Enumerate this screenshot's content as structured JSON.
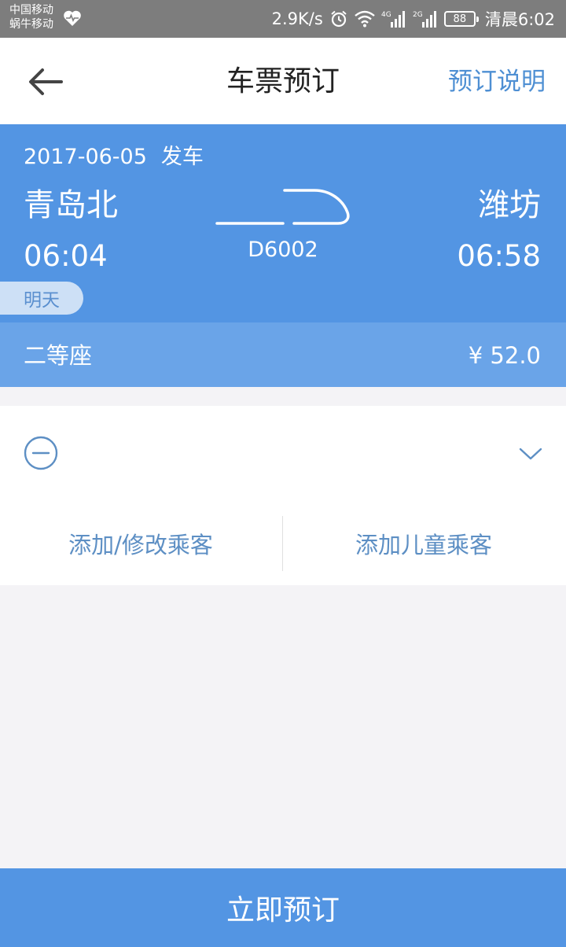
{
  "status_bar": {
    "carrier_1": "中国移动",
    "carrier_2": "蜗牛移动",
    "net_speed": "2.9K/s",
    "battery": "88",
    "time": "清晨6:02",
    "icons": [
      "heart-rate-icon",
      "alarm-icon",
      "wifi-icon",
      "signal-4g-icon",
      "signal-2g-icon",
      "battery-icon"
    ]
  },
  "header": {
    "title": "车票预订",
    "help_label": "预订说明",
    "back_icon": "back-arrow-icon"
  },
  "train": {
    "date": "2017-06-05",
    "date_suffix": "发车",
    "from_station": "青岛北",
    "to_station": "潍坊",
    "depart_time": "06:04",
    "arrive_time": "06:58",
    "train_number": "D6002",
    "arrival_badge": "明天"
  },
  "seat": {
    "type": "二等座",
    "price": "¥ 52.0"
  },
  "passengers": {
    "add_passenger_label": "添加/修改乘客",
    "add_child_label": "添加儿童乘客"
  },
  "footer": {
    "book_now_label": "立即预订"
  },
  "colors": {
    "primary": "#5395e3",
    "seat_row": "#6aa4e8",
    "link": "#4e8fd3",
    "background": "#f4f3f6"
  }
}
